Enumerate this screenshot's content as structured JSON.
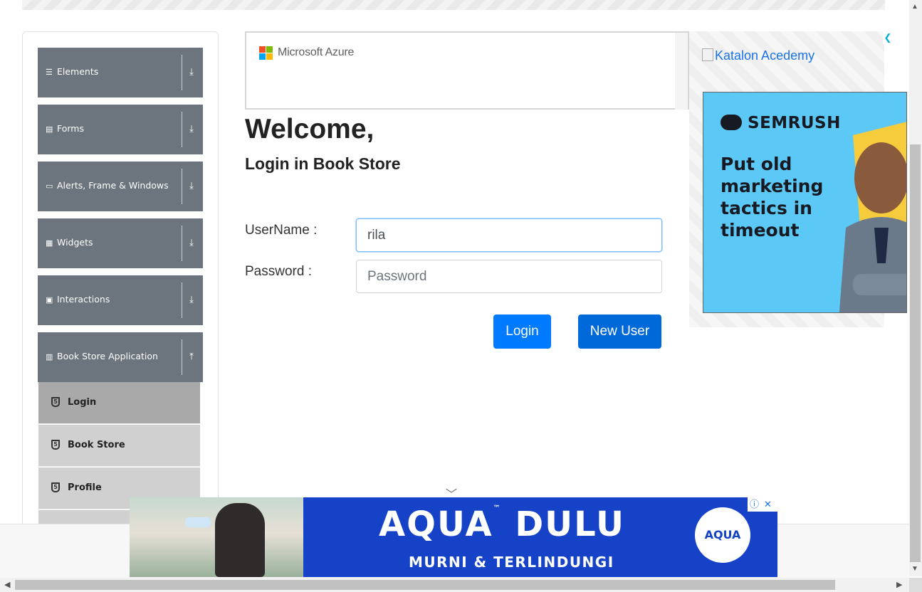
{
  "sidebar": {
    "groups": [
      {
        "label": "Elements",
        "icon": "menu-icon"
      },
      {
        "label": "Forms",
        "icon": "form-icon"
      },
      {
        "label": "Alerts, Frame & Windows",
        "icon": "window-icon"
      },
      {
        "label": "Widgets",
        "icon": "widgets-icon"
      },
      {
        "label": "Interactions",
        "icon": "interactions-icon"
      },
      {
        "label": "Book Store Application",
        "icon": "book-icon",
        "expanded": true
      }
    ],
    "subitems": [
      {
        "label": "Login",
        "active": true
      },
      {
        "label": "Book Store"
      },
      {
        "label": "Profile"
      }
    ]
  },
  "ad_top": {
    "brand": "Microsoft Azure"
  },
  "main": {
    "title": "Welcome,",
    "subtitle": "Login in Book Store",
    "username_label": "UserName :",
    "username_value": "rila",
    "password_label": "Password :",
    "password_placeholder": "Password",
    "login_button": "Login",
    "new_user_button": "New User"
  },
  "ad_right": {
    "katalon_alt": "Katalon Acedemy",
    "semrush_logo": "SEMRUSH",
    "semrush_tagline": "Put old marketing tactics in timeout"
  },
  "ad_bottom": {
    "title": "AQUA",
    "tm": "™",
    "title2": "DULU",
    "subtitle": "MURNI & TERLINDUNGI",
    "badge": "AQUA"
  },
  "colors": {
    "primary": "#007bff",
    "sidebar": "#6c757d",
    "aqua_blue": "#1642c7",
    "semrush_bg": "#5bc8f5"
  }
}
